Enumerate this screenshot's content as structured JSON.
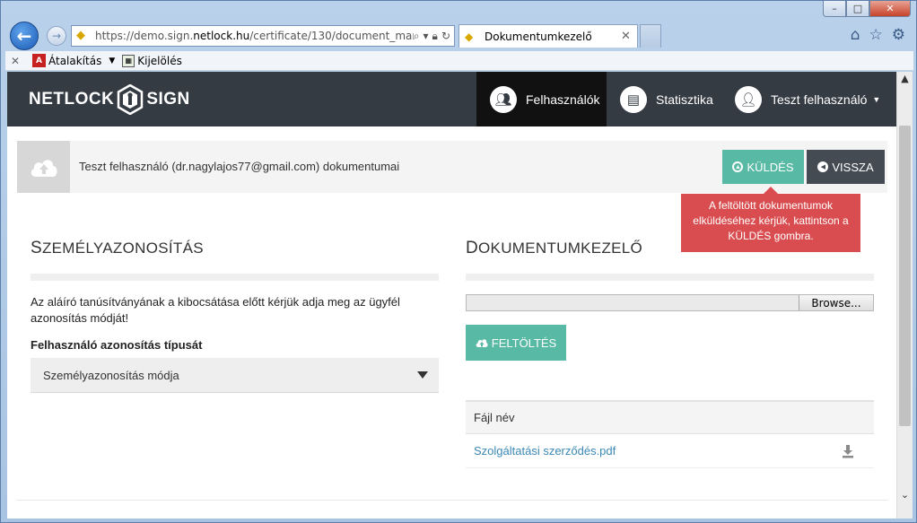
{
  "browser": {
    "url_prefix": "https://demo.sign.",
    "url_domain": "netlock.hu",
    "url_suffix": "/certificate/130/document_mana",
    "tab_title": "Dokumentumkezelő",
    "cmd_items": [
      "Átalakítás",
      "Kijelölés"
    ],
    "caption": {
      "min": "–",
      "max": "□",
      "close": "✕"
    }
  },
  "app": {
    "logo_left": "NETLOCK",
    "logo_right": "SIGN",
    "nav": {
      "users": "Felhasználók",
      "stats": "Statisztika",
      "user_menu": "Teszt felhasználó"
    }
  },
  "header": {
    "title": "Teszt felhasználó (dr.nagylajos77@gmail.com) dokumentumai",
    "send_label": "KÜLDÉS",
    "back_label": "VISSZA",
    "tooltip": "A feltöltött dokumentumok elküldéséhez kérjük, kattintson a KÜLDÉS gombra."
  },
  "identity": {
    "title_first": "S",
    "title_rest": "ZEMÉLYAZONOSÍTÁS",
    "description": "Az aláíró tanúsítványának a kibocsátása előtt kérjük adja meg az ügyfél azonosítás módját!",
    "type_label": "Felhasználó azonosítás típusát",
    "select_value": "Személyazonosítás módja"
  },
  "documents": {
    "title_first": "D",
    "title_rest": "OKUMENTUMKEZELŐ",
    "browse_label": "Browse...",
    "upload_label": "FELTÖLTÉS",
    "column_filename": "Fájl név",
    "files": [
      "Szolgáltatási szerződés.pdf"
    ]
  },
  "colors": {
    "accent": "#58b9a5",
    "navbar": "#353b43",
    "danger": "#d94d50",
    "link": "#3b88b5"
  }
}
